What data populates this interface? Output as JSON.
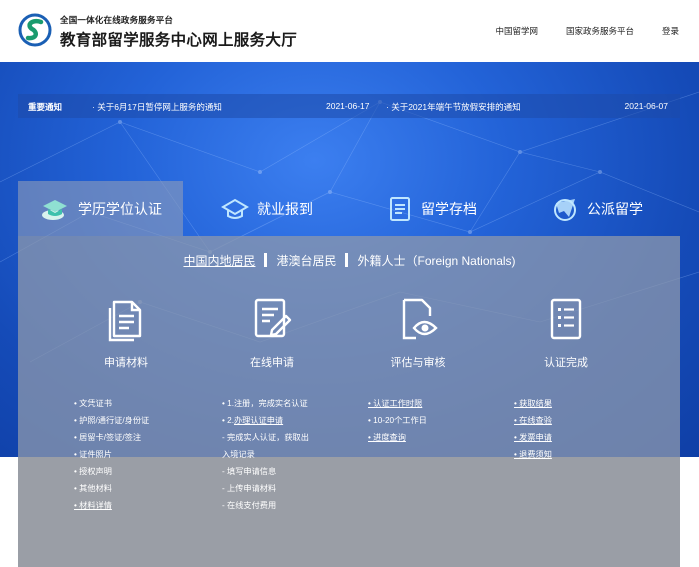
{
  "header": {
    "platform_sub": "全国一体化在线政务服务平台",
    "site_title": "教育部留学服务中心网上服务大厅",
    "nav": [
      "中国留学网",
      "国家政务服务平台",
      "登录"
    ]
  },
  "notice": {
    "tag": "重要通知",
    "items": [
      {
        "text": "· 关于6月17日暂停网上服务的通知",
        "date": "2021-06-17"
      },
      {
        "text": "· 关于2021年端午节放假安排的通知",
        "date": "2021-06-07"
      }
    ]
  },
  "tabs": [
    {
      "label": "学历学位认证",
      "icon": "graduation-cap-icon",
      "active": true
    },
    {
      "label": "就业报到",
      "icon": "employment-cap-icon",
      "active": false
    },
    {
      "label": "留学存档",
      "icon": "archive-document-icon",
      "active": false
    },
    {
      "label": "公派留学",
      "icon": "airplane-globe-icon",
      "active": false
    }
  ],
  "residency": [
    "中国内地居民",
    "港澳台居民",
    "外籍人士（Foreign Nationals)"
  ],
  "steps": [
    {
      "label": "申请材料",
      "icon": "document-stack-icon"
    },
    {
      "label": "在线申请",
      "icon": "edit-form-icon"
    },
    {
      "label": "评估与审核",
      "icon": "review-eye-icon"
    },
    {
      "label": "认证完成",
      "icon": "checklist-icon"
    }
  ],
  "lists": {
    "materials": [
      {
        "text": "• 文凭证书",
        "link": false
      },
      {
        "text": "• 护照/通行证/身份证",
        "link": false
      },
      {
        "text": "• 居留卡/签证/签注",
        "link": false
      },
      {
        "text": "• 证件照片",
        "link": false
      },
      {
        "text": "• 授权声明",
        "link": false
      },
      {
        "text": "• 其他材料",
        "link": false
      },
      {
        "text": "• 材料详情",
        "link": true
      }
    ],
    "apply": [
      {
        "text": "• 1.注册，完成实名认证",
        "link": false
      },
      {
        "text": "• 2.办理认证申请",
        "link": true
      },
      {
        "text": "  - 完成实人认证，获取出",
        "link": false
      },
      {
        "text": "  入境记录",
        "link": false
      },
      {
        "text": "  - 填写申请信息",
        "link": false
      },
      {
        "text": "  - 上传申请材料",
        "link": false
      },
      {
        "text": "  - 在线支付费用",
        "link": false
      }
    ],
    "review": [
      {
        "text": "• 认证工作时限",
        "link": true
      },
      {
        "text": "• 10-20个工作日",
        "link": false
      },
      {
        "text": "• 进度查询",
        "link": true
      }
    ],
    "complete": [
      {
        "text": "• 获取结果",
        "link": true
      },
      {
        "text": "• 在线查验",
        "link": true
      },
      {
        "text": "• 发票申请",
        "link": true
      },
      {
        "text": "• 退费须知",
        "link": true
      }
    ]
  },
  "colors": {
    "hero_blue": "#2363d8",
    "panel_gray": "#8e98ac",
    "logo_green": "#1a9b6e",
    "logo_blue": "#1a5fb4"
  }
}
